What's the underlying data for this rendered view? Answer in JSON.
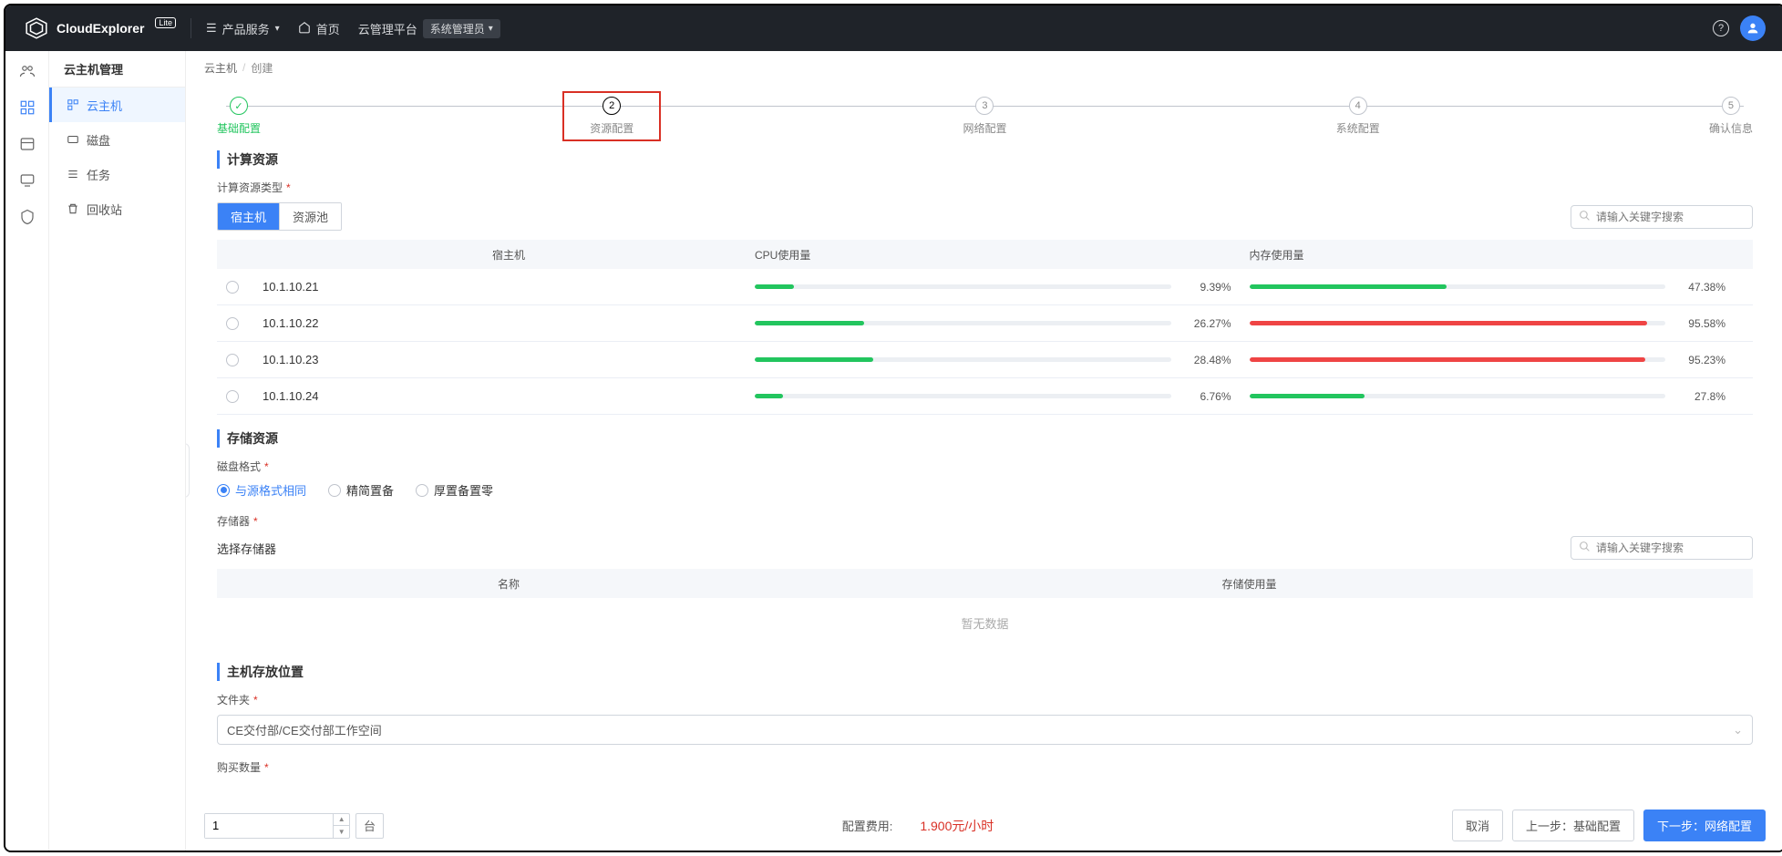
{
  "brand": {
    "name": "CloudExplorer",
    "badge": "Lite"
  },
  "topnav": {
    "products": "产品服务",
    "home": "首页",
    "platform": "云管理平台",
    "role": "系统管理员"
  },
  "rail": [
    "users",
    "grid",
    "storage",
    "monitor",
    "shield"
  ],
  "sidebar": {
    "title": "云主机管理",
    "items": [
      {
        "key": "vm",
        "label": "云主机",
        "active": true
      },
      {
        "key": "disk",
        "label": "磁盘",
        "active": false
      },
      {
        "key": "task",
        "label": "任务",
        "active": false
      },
      {
        "key": "trash",
        "label": "回收站",
        "active": false
      }
    ]
  },
  "breadcrumb": {
    "root": "云主机",
    "current": "创建"
  },
  "steps": [
    {
      "n": "✓",
      "label": "基础配置",
      "state": "done"
    },
    {
      "n": "2",
      "label": "资源配置",
      "state": "active"
    },
    {
      "n": "3",
      "label": "网络配置",
      "state": "idle"
    },
    {
      "n": "4",
      "label": "系统配置",
      "state": "idle"
    },
    {
      "n": "5",
      "label": "确认信息",
      "state": "idle"
    }
  ],
  "sections": {
    "compute": "计算资源",
    "compute_type": "计算资源类型",
    "storage": "存储资源",
    "disk_fmt": "磁盘格式",
    "store": "存储器",
    "store_sel": "选择存储器",
    "placement": "主机存放位置",
    "folder": "文件夹",
    "qty": "购买数量"
  },
  "segs": {
    "host": "宿主机",
    "pool": "资源池"
  },
  "search_placeholder": "请输入关键字搜索",
  "host_table": {
    "cols": {
      "host": "宿主机",
      "cpu": "CPU使用量",
      "mem": "内存使用量"
    },
    "rows": [
      {
        "host": "10.1.10.21",
        "cpu": 9.39,
        "mem": 47.38
      },
      {
        "host": "10.1.10.22",
        "cpu": 26.27,
        "mem": 95.58
      },
      {
        "host": "10.1.10.23",
        "cpu": 28.48,
        "mem": 95.23
      },
      {
        "host": "10.1.10.24",
        "cpu": 6.76,
        "mem": 27.8
      }
    ]
  },
  "disk_fmt_opts": [
    "与源格式相同",
    "精简置备",
    "厚置备置零"
  ],
  "storage_table": {
    "cols": {
      "name": "名称",
      "usage": "存储使用量"
    },
    "empty": "暂无数据"
  },
  "folder_value": "CE交付部/CE交付部工作空间",
  "qty_value": "1",
  "unit": "台",
  "footer": {
    "cost_label": "配置费用:",
    "cost_value": "1.900元/小时",
    "cancel": "取消",
    "prev": "上一步：基础配置",
    "next": "下一步：网络配置"
  },
  "colors": {
    "green": "#22c55e",
    "red": "#ef4444",
    "blue": "#3b82f6"
  }
}
